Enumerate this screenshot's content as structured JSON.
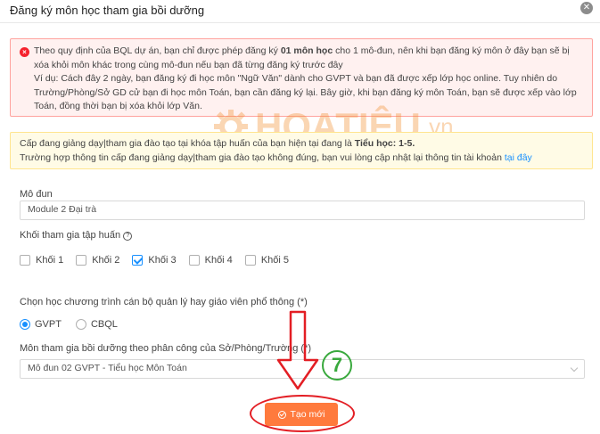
{
  "modal": {
    "title": "Đăng ký môn học tham gia bồi dưỡng",
    "close_glyph": "✕"
  },
  "alert_error": {
    "icon_glyph": "×",
    "line1_pre": "Theo quy định của BQL dự án, bạn chỉ được phép đăng ký ",
    "line1_bold": "01 môn học",
    "line1_post": " cho 1 mô-đun, nên khi bạn đăng ký môn ở đây bạn sẽ bị",
    "line2": "xóa khỏi môn khác trong cùng mô-đun nếu bạn đã từng đăng ký trước đây",
    "line3": "Ví dụ: Cách đây 2 ngày, bạn đăng ký đi học môn \"Ngữ Văn\" dành cho GVPT và bạn đã được xếp lớp học online. Tuy nhiên do",
    "line4": "Trường/Phòng/Sở GD cử bạn đi học môn Toán, bạn cần đăng ký lại. Bây giờ, khi bạn đăng ký môn Toán, bạn sẽ được xếp vào lớp",
    "line5": "Toán, đồng thời bạn bị xóa khỏi lớp Văn."
  },
  "alert_warn": {
    "line1_pre": "Cấp đang giảng dạy|tham gia đào tạo tại khóa tập huấn của bạn hiện tại đang là ",
    "line1_bold": "Tiểu học: 1-5.",
    "line2_pre": "Trường hợp thông tin cấp đang giảng dạy|tham gia đào tạo không đúng, bạn vui lòng cập nhật lại thông tin tài khoản ",
    "line2_link": "tại đây"
  },
  "module": {
    "label": "Mô đun",
    "value": "Module 2 Đại trà"
  },
  "grades": {
    "label": "Khối tham gia tập huấn",
    "help_glyph": "?",
    "items": [
      {
        "label": "Khối 1",
        "checked": false
      },
      {
        "label": "Khối 2",
        "checked": false
      },
      {
        "label": "Khối 3",
        "checked": true
      },
      {
        "label": "Khối 4",
        "checked": false
      },
      {
        "label": "Khối 5",
        "checked": false
      }
    ]
  },
  "program": {
    "label": "Chọn học chương trình cán bộ quản lý hay giáo viên phổ thông (*)",
    "options": [
      {
        "label": "GVPT",
        "checked": true
      },
      {
        "label": "CBQL",
        "checked": false
      }
    ]
  },
  "subject": {
    "label": "Môn tham gia bồi dưỡng theo phân công của Sở/Phòng/Trường (*)",
    "value": "Mô đun 02 GVPT - Tiểu học Môn Toán"
  },
  "submit": {
    "label": "Tạo mới"
  },
  "annotation": {
    "step_number": "7",
    "arrow_color": "#e31e24",
    "step_color": "#39a93d"
  },
  "watermark": {
    "text": "HOATIỆU",
    "suffix": ".vn",
    "color": "#f28c28"
  },
  "colors": {
    "primary": "#1890ff",
    "button": "#ff7a3d",
    "error_bg": "#fff1f0",
    "warn_bg": "#fffbe6"
  }
}
